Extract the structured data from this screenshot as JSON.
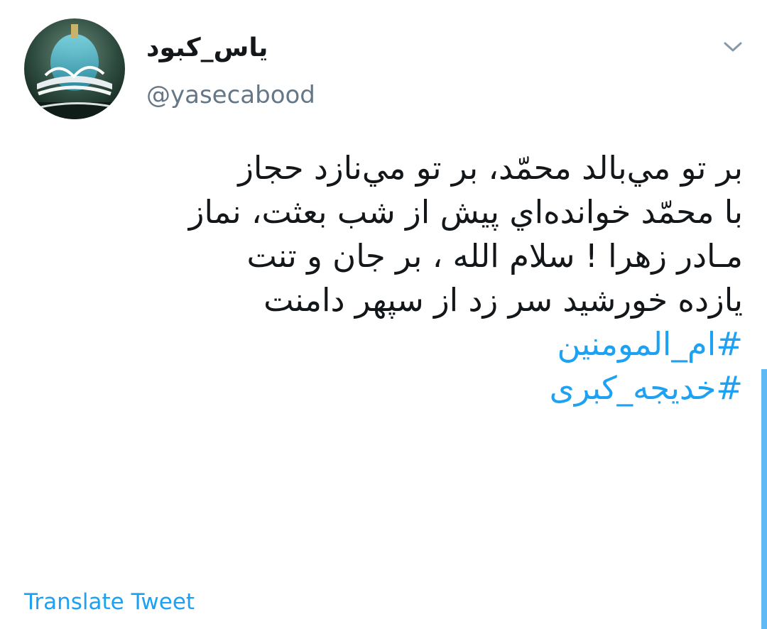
{
  "author": {
    "display_name": "یاس_کبود",
    "handle": "@yasecabood",
    "avatar": "avatar-image"
  },
  "tweet": {
    "lines": [
      "بر تو مي‌بالد محمّد، بر تو مي‌نازد حجاز",
      "با محمّد خوانده‌اي پيش از شب بعثت، نماز",
      "مـادر زهرا ! سلام الله ، بر جان و تنت",
      "يازده خورشيد سر زد از سپهر دامنت"
    ],
    "hashtags": [
      "#ام_المومنین",
      "#خدیجه_کبری"
    ]
  },
  "actions": {
    "translate_label": "Translate Tweet",
    "menu_icon": "chevron-down-icon"
  },
  "colors": {
    "link": "#1da1f2",
    "secondary_text": "#657786",
    "primary_text": "#14171a"
  }
}
